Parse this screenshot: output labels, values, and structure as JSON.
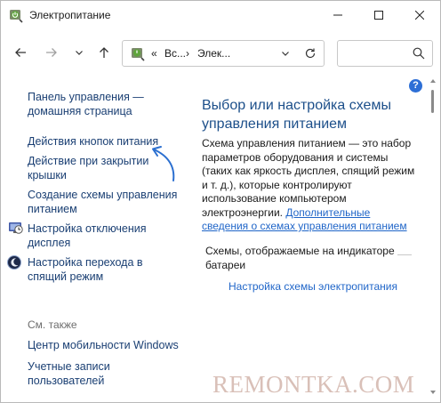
{
  "window": {
    "title": "Электропитание"
  },
  "address_bar": {
    "overflow_label": "«",
    "segments": [
      "Вс...",
      "Элек..."
    ],
    "separator": "›"
  },
  "sidebar": {
    "items": [
      {
        "label_line1": "Панель управления —",
        "label_line2": "домашняя страница"
      },
      {
        "label_line1": "Действия кнопок питания"
      },
      {
        "label_line1": "Действие при закрытии",
        "label_line2": "крышки"
      },
      {
        "label_line1": "Создание схемы управления",
        "label_line2": "питанием"
      },
      {
        "label_line1": "Настройка отключения",
        "label_line2": "дисплея",
        "icon": "display-timer-icon"
      },
      {
        "label_line1": "Настройка перехода в",
        "label_line2": "спящий режим",
        "icon": "sleep-moon-icon"
      }
    ],
    "see_also": {
      "heading": "См. также",
      "items": [
        {
          "label_line1": "Центр мобильности Windows"
        },
        {
          "label_line1": "Учетные записи",
          "label_line2": "пользователей"
        }
      ]
    }
  },
  "main": {
    "title_line1": "Выбор или настройка схемы",
    "title_line2": "управления питанием",
    "description_lines": [
      "Схема управления питанием — это набор",
      "параметров оборудования и системы",
      "(таких как яркость дисплея, спящий режим",
      "и т. д.), которые контролируют",
      "использование компьютером",
      "электроэнергии."
    ],
    "description_link_line1": "Дополнительные",
    "description_link_line2": "сведения о схемах управления питанием",
    "schemes_label_line1": "Схемы, отображаемые на индикаторе",
    "schemes_label_line2": "батареи",
    "configure_link": "Настройка схемы электропитания",
    "help_label": "?"
  },
  "watermark": "REMONTKA.COM",
  "colors": {
    "link": "#1a3f73",
    "title": "#1c4f8a",
    "hyperlink": "#1f65c8",
    "annotation_arrow": "#2b6fd0",
    "watermark": "#d9c0b8"
  }
}
